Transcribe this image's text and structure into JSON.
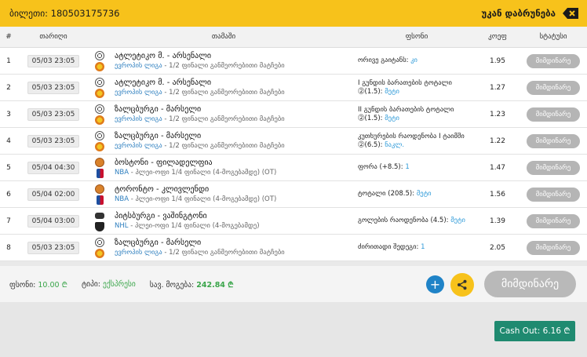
{
  "header": {
    "ticket_label": "ბილეთი: 180503175736",
    "back_label": "უკან დაბრუნება"
  },
  "columns": {
    "num": "#",
    "date": "თარიღი",
    "match": "თამაში",
    "bet": "ფსონი",
    "odd": "კოეფ",
    "status": "სტატუსი"
  },
  "rows": [
    {
      "num": "1",
      "date": "05/03 23:05",
      "sport_icon": "soccer-ball-icon",
      "league_icon": "europa-league-icon",
      "teams": "ატლეტიკო მ. - არსენალი",
      "league_name": "ევროპის ლიგა",
      "league_rest": " - 1/2 ფინალი განმეორებითი მატჩები",
      "bet_text": "ორივე გაიტანს: ",
      "bet_sel": "კი",
      "odd": "1.95",
      "status": "მიმდინარე"
    },
    {
      "num": "2",
      "date": "05/03 23:05",
      "sport_icon": "soccer-ball-icon",
      "league_icon": "europa-league-icon",
      "teams": "ატლეტიკო მ. - არსენალი",
      "league_name": "ევროპის ლიგა",
      "league_rest": " - 1/2 ფინალი განმეორებითი მატჩები",
      "bet_text": "I გუნდის ბარათების ტოტალი ⓶(1.5): ",
      "bet_sel": "მეტი",
      "odd": "1.27",
      "status": "მიმდინარე"
    },
    {
      "num": "3",
      "date": "05/03 23:05",
      "sport_icon": "soccer-ball-icon",
      "league_icon": "europa-league-icon",
      "teams": "ზალცბურგი - მარსელი",
      "league_name": "ევროპის ლიგა",
      "league_rest": " - 1/2 ფინალი განმეორებითი მატჩები",
      "bet_text": "II გუნდის ბარათების ტოტალი ⓶(1.5): ",
      "bet_sel": "მეტი",
      "odd": "1.23",
      "status": "მიმდინარე"
    },
    {
      "num": "4",
      "date": "05/03 23:05",
      "sport_icon": "soccer-ball-icon",
      "league_icon": "europa-league-icon",
      "teams": "ზალცბურგი - მარსელი",
      "league_name": "ევროპის ლიგა",
      "league_rest": " - 1/2 ფინალი განმეორებითი მატჩები",
      "bet_text": "კუთხურების რაოდენობა I ტაიმში ⓶(6.5): ",
      "bet_sel": "ნაკლ.",
      "odd": "1.22",
      "status": "მიმდინარე"
    },
    {
      "num": "5",
      "date": "05/04 04:30",
      "sport_icon": "basketball-icon",
      "league_icon": "nba-icon",
      "teams": "ბოსტონი - ფილადელფია",
      "league_name": "NBA",
      "league_rest": " - პლეი-ოფი 1/4 ფინალი (4-მოგებამდე) (OT)",
      "bet_text": "ფორა (+8.5): ",
      "bet_sel": "1",
      "odd": "1.47",
      "status": "მიმდინარე"
    },
    {
      "num": "6",
      "date": "05/04 02:00",
      "sport_icon": "basketball-icon",
      "league_icon": "nba-icon",
      "teams": "ტორონტო - კლივლენდი",
      "league_name": "NBA",
      "league_rest": " - პლეი-ოფი 1/4 ფინალი (4-მოგებამდე) (OT)",
      "bet_text": "ტოტალი (208.5): ",
      "bet_sel": "მეტი",
      "odd": "1.56",
      "status": "მიმდინარე"
    },
    {
      "num": "7",
      "date": "05/04 03:00",
      "sport_icon": "hockey-puck-icon",
      "league_icon": "nhl-icon",
      "teams": "პიტსბურგი - ვაშინგტონი",
      "league_name": "NHL",
      "league_rest": " - პლეი-ოფი 1/4 ფინალი (4-მოგებამდე)",
      "bet_text": "გოლების რაოდენობა (4.5): ",
      "bet_sel": "მეტი",
      "odd": "1.39",
      "status": "მიმდინარე"
    },
    {
      "num": "8",
      "date": "05/03 23:05",
      "sport_icon": "soccer-ball-icon",
      "league_icon": "europa-league-icon",
      "teams": "ზალცბურგი - მარსელი",
      "league_name": "ევროპის ლიგა",
      "league_rest": " - 1/2 ფინალი განმეორებითი მატჩები",
      "bet_text": "ძირითადი შედეგი: ",
      "bet_sel": "1",
      "odd": "2.05",
      "status": "მიმდინარე"
    }
  ],
  "summary": {
    "stake_label": "ფსონი:",
    "stake_value": "10.00 ₾",
    "type_label": "ტიპი:",
    "type_value": "ექსპრესი",
    "win_label": "სავ. მოგება:",
    "win_value": "242.84 ₾",
    "status_label": "მიმდინარე"
  },
  "cashout": {
    "label": "Cash Out: 6.16 ₾"
  },
  "colors": {
    "header": "#f7c21b",
    "accent_green": "#3aa54a",
    "cashout_bg": "#1f8a70",
    "link_blue": "#2e9ad8"
  }
}
